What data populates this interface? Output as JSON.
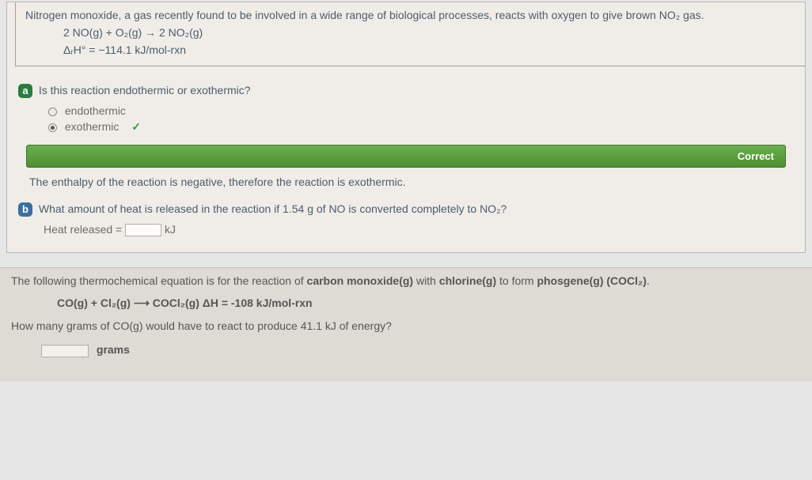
{
  "p1": {
    "intro": "Nitrogen monoxide, a gas recently found to be involved in a wide range of biological processes, reacts with oxygen to give brown NO₂ gas.",
    "eq": "2 NO(g) + O₂(g) → 2 NO₂(g)",
    "dh": "ΔᵣH° = −114.1 kJ/mol-rxn",
    "a": {
      "badge": "a",
      "q": "Is this reaction endothermic or exothermic?",
      "opt1": "endothermic",
      "opt2": "exothermic",
      "check": "✓",
      "correct": "Correct",
      "explain": "The enthalpy of the reaction is negative, therefore the reaction is exothermic."
    },
    "b": {
      "badge": "b",
      "q": "What amount of heat is released in the reaction if 1.54 g of NO is converted completely to NO₂?",
      "label": "Heat released =",
      "unit": "kJ"
    }
  },
  "p2": {
    "intro_a": "The following thermochemical equation is for the reaction of ",
    "intro_b": "carbon monoxide(g)",
    "intro_c": " with ",
    "intro_d": "chlorine(g)",
    "intro_e": " to form ",
    "intro_f": "phosgene(g) (COCl₂)",
    "intro_g": ".",
    "eq": "CO(g) + Cl₂(g) ⟶ COCl₂(g)     ΔH = -108 kJ/mol-rxn",
    "q": "How many grams of CO(g) would have to react to produce 41.1 kJ of energy?",
    "unit": "grams"
  },
  "chart_data": {
    "type": "table",
    "title": "Thermochemistry problems",
    "reactions": [
      {
        "equation": "2 NO(g) + O2(g) -> 2 NO2(g)",
        "delta_H_kJ_per_mol_rxn": -114.1
      },
      {
        "equation": "CO(g) + Cl2(g) -> COCl2(g)",
        "delta_H_kJ_per_mol_rxn": -108
      }
    ],
    "given": {
      "mass_NO_g": 1.54,
      "target_energy_kJ": 41.1
    }
  }
}
